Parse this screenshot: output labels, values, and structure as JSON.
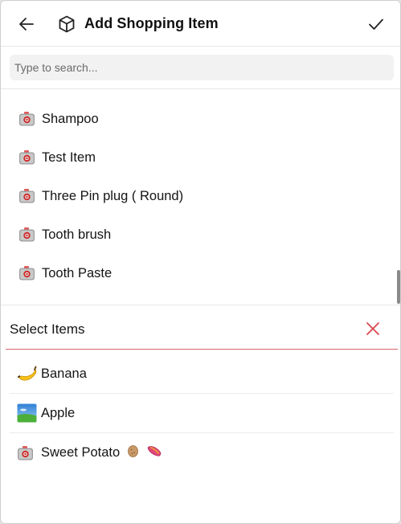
{
  "header": {
    "title": "Add Shopping Item",
    "back_icon": "arrow-left-icon",
    "title_icon": "box-icon",
    "confirm_icon": "check-icon"
  },
  "search": {
    "placeholder": "Type to search...",
    "value": ""
  },
  "results": [
    {
      "label": "Shampoo",
      "icon": "camera-icon"
    },
    {
      "label": "Test Item",
      "icon": "camera-icon"
    },
    {
      "label": "Three Pin plug ( Round)",
      "icon": "camera-icon"
    },
    {
      "label": "Tooth brush",
      "icon": "camera-icon"
    },
    {
      "label": "Tooth Paste",
      "icon": "camera-icon"
    }
  ],
  "selected": {
    "title": "Select Items",
    "clear_icon": "close-icon",
    "items": [
      {
        "label": "Banana",
        "icon": "banana-icon"
      },
      {
        "label": "Apple",
        "icon": "landscape-icon"
      },
      {
        "label": "Sweet Potato",
        "icon": "camera-icon"
      }
    ]
  },
  "colors": {
    "accent_red": "#d9636d",
    "camera_red": "#cc2a2a"
  }
}
